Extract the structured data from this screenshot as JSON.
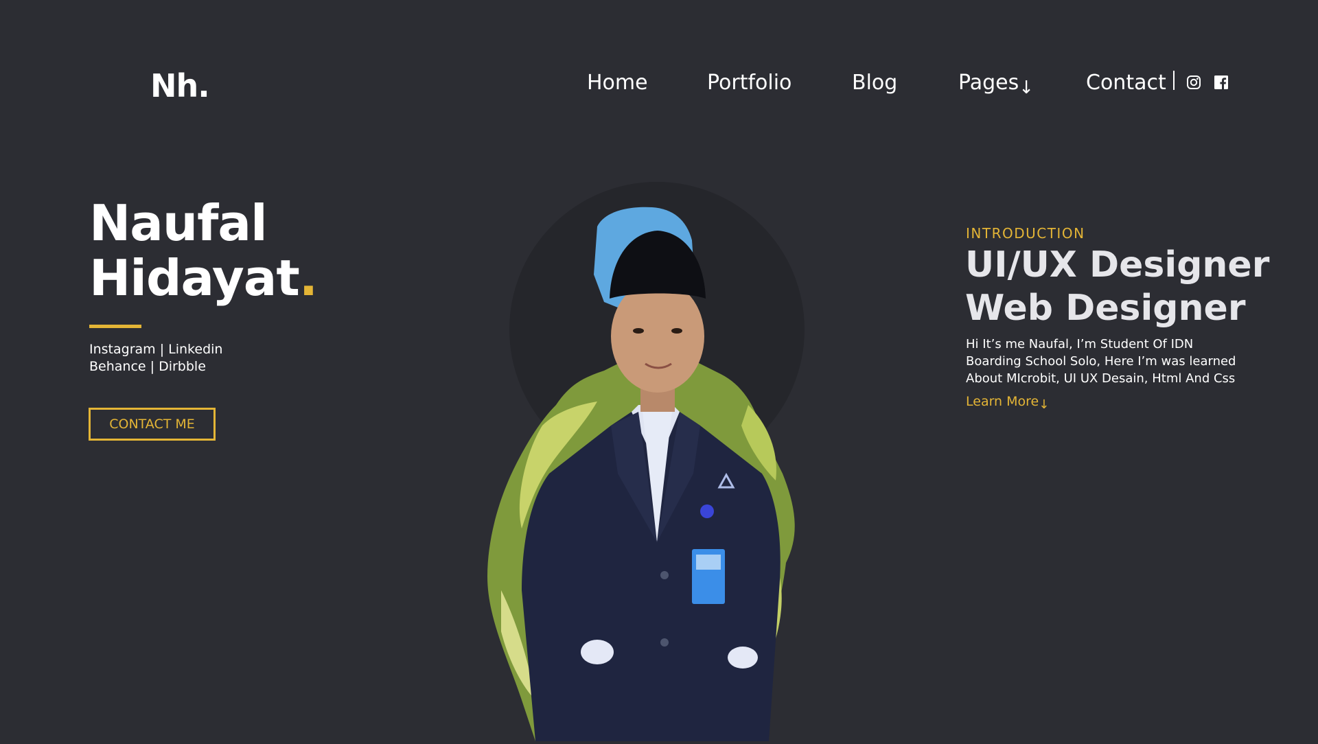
{
  "logo": "Nh.",
  "nav": {
    "items": [
      "Home",
      "Portfolio",
      "Blog",
      "Pages",
      "Contact"
    ],
    "pages_arrow": "↓"
  },
  "social_icons": [
    "instagram-icon",
    "facebook-icon"
  ],
  "hero": {
    "first_name": "Naufal",
    "last_name": "Hidayat",
    "dot": ".",
    "social_line_1": "Instagram | Linkedin",
    "social_line_2": "Behance | Dirbble",
    "contact_button": "CONTACT ME"
  },
  "intro": {
    "label": "INTRODUCTION",
    "title_line_1": "UI/UX Designer",
    "title_line_2": "Web Designer",
    "desc_line_1": "Hi It’s me Naufal, I’m Student Of IDN",
    "desc_line_2": "Boarding School Solo, Here I’m was learned",
    "desc_line_3": "About MIcrobit, UI UX Desain, Html And Css",
    "learn_more": "Learn More",
    "learn_more_arrow": "↓"
  },
  "colors": {
    "background": "#2c2d33",
    "accent": "#e4b536",
    "text": "#ffffff"
  }
}
